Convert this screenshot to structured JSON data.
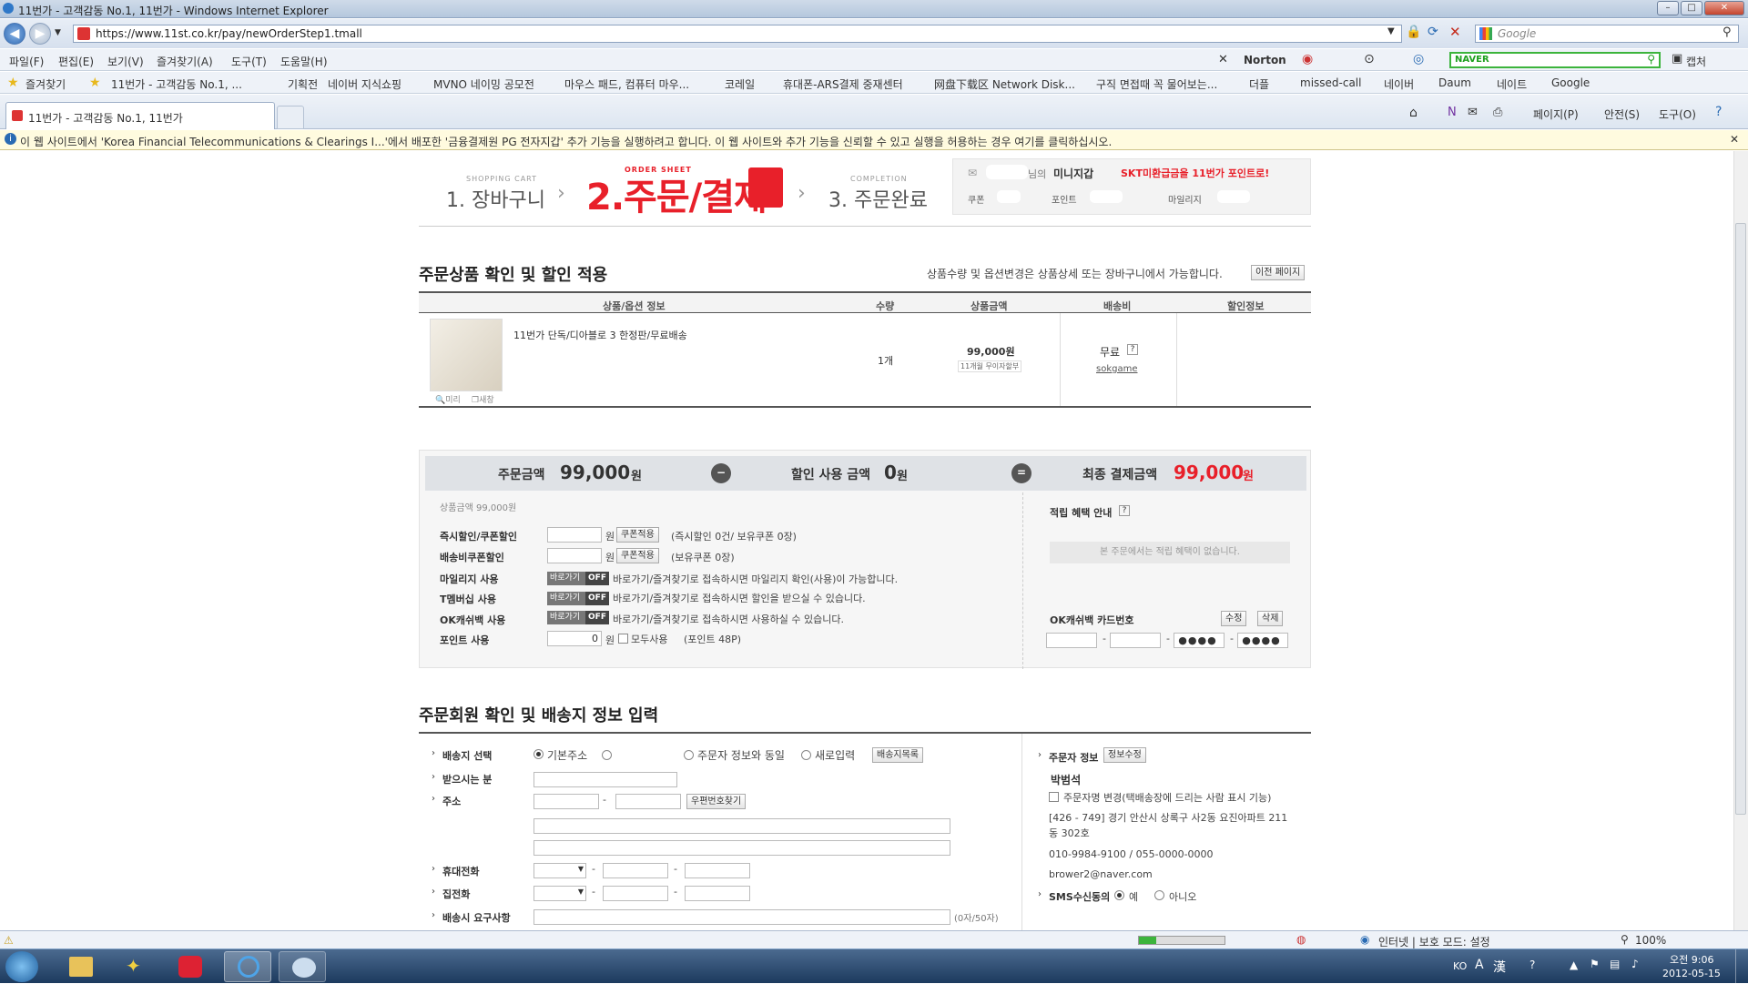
{
  "window": {
    "title": "11번가 - 고객감동 No.1, 11번가 - Windows Internet Explorer"
  },
  "address": {
    "url": "https://www.11st.co.kr/pay/newOrderStep1.tmall",
    "search_placeholder": "Google"
  },
  "menu": [
    "파일(F)",
    "편집(E)",
    "보기(V)",
    "즐겨찾기(A)",
    "도구(T)",
    "도움말(H)"
  ],
  "toolbar_right": {
    "norton": "Norton",
    "naver": "NAVER",
    "capture": "캡처"
  },
  "favorites": {
    "label": "즐겨찾기",
    "items": [
      "11번가 - 고객감동 No.1, ...",
      "기획전",
      "네이버 지식쇼핑",
      "MVNO 네이밍 공모전",
      "마우스 패드, 컴퓨터 마우...",
      "코레일",
      "휴대폰-ARS결제 중재센터",
      "网盘下载区 Network Disk...",
      "구직 면접때 꼭 물어보는...",
      "더플",
      "missed-call",
      "네이버",
      "Daum",
      "네이트",
      "Google"
    ]
  },
  "tab": {
    "title": "11번가 - 고객감동 No.1, 11번가"
  },
  "cmdbar": [
    "페이지(P)",
    "안전(S)",
    "도구(O)"
  ],
  "infobar": {
    "text": "이 웹 사이트에서 'Korea Financial Telecommunications & Clearings I...'에서 배포한 '금융결제원 PG 전자지갑' 추가 기능을 실행하려고 합니다. 이 웹 사이트와 추가 기능을 신뢰할 수 있고 실행을 허용하는 경우 여기를 클릭하십시오."
  },
  "steps": {
    "s1_en": "SHOPPING CART",
    "s1": "1. 장바구니",
    "s2_en": "ORDER SHEET",
    "s2": "2.주문/결제",
    "s3_en": "COMPLETION",
    "s3": "3. 주문완료"
  },
  "wallet": {
    "suffix": "님의",
    "title": "미니지갑",
    "promo": "SKT미환급금을 11번가 포인트로!",
    "coupon": "쿠폰",
    "point": "포인트",
    "mileage": "마일리지"
  },
  "order": {
    "title": "주문상품 확인 및 할인 적용",
    "note": "상품수량 및 옵션변경은 상품상세 또는 장바구니에서 가능합니다.",
    "prev_button": "이전 페이지",
    "headers": [
      "상품/옵션 정보",
      "수량",
      "상품금액",
      "배송비",
      "할인정보"
    ],
    "item": {
      "name": "11번가 단독/디아블로 3 한정판/무료배송",
      "qty": "1개",
      "price": "99,000원",
      "installment": "11개월 무이자할부",
      "shipping": "무료",
      "seller": "sokgame",
      "preview": "미리",
      "newwin": "새창"
    }
  },
  "summary": {
    "order_label": "주문금액",
    "order_amount": "99,000",
    "won": "원",
    "discount_label": "할인 사용 금액",
    "discount_amount": "0",
    "final_label": "최종 결제금액",
    "final_amount": "99,000",
    "goods_amount": "상품금액  99,000원"
  },
  "discounts": {
    "instant_label": "즉시할인/쿠폰할인",
    "instant_info": "(즉시할인 0건/ 보유쿠폰 0장)",
    "ship_label": "배송비쿠폰할인",
    "ship_info": "(보유쿠폰 0장)",
    "coupon_btn": "쿠폰적용",
    "mileage_label": "마일리지 사용",
    "mileage_info": "바로가기/즐겨찾기로 접속하시면 마일리지 확인(사용)이 가능합니다.",
    "tmember_label": "T멤버십 사용",
    "tmember_info": "바로가기/즐겨찾기로 접속하시면 할인을 받으실 수 있습니다.",
    "okcash_label": "OK캐쉬백 사용",
    "okcash_info": "바로가기/즐겨찾기로 접속하시면 사용하실 수 있습니다.",
    "point_label": "포인트 사용",
    "point_value": "0",
    "point_all": "모두사용",
    "point_info": "(포인트 48P)",
    "off_text": "바로가기",
    "off": "OFF"
  },
  "benefit": {
    "title": "적립 혜택 안내",
    "empty": "본 주문에서는 적립 혜택이 없습니다.",
    "okcard_label": "OK캐쉬백 카드번호",
    "edit": "수정",
    "delete": "삭제",
    "mask": "●●●●"
  },
  "shipping": {
    "title": "주문회원 확인 및 배송지 정보 입력",
    "select_label": "배송지 선택",
    "opt_basic": "기본주소",
    "opt_same": "주문자 정보와 동일",
    "opt_new": "새로입력",
    "list_btn": "배송지목록",
    "receiver_label": "받으시는 분",
    "addr_label": "주소",
    "zip_btn": "우편번호찾기",
    "mobile_label": "휴대전화",
    "home_label": "집전화",
    "request_label": "배송시 요구사항",
    "request_count": "(0자/50자)"
  },
  "orderer": {
    "label": "주문자 정보",
    "edit_btn": "정보수정",
    "name": "박범석",
    "change_name": "주문자명 변경(택배송장에 드리는 사람 표시 기능)",
    "address": "[426 - 749] 경기 안산시 상록구 사2동 요진아파트 211",
    "address2": "동 302호",
    "phone": "010-9984-9100 / 055-0000-0000",
    "email": "brower2@naver.com",
    "sms_label": "SMS수신동의",
    "yes": "예",
    "no": "아니오"
  },
  "status": {
    "zone": "인터넷 | 보호 모드: 설정",
    "zoom": "100%"
  },
  "taskbar": {
    "lang": "KO",
    "time": "오전 9:06",
    "date": "2012-05-15"
  },
  "colors": {
    "accent": "#e8202a",
    "grey_header": "#666666"
  }
}
